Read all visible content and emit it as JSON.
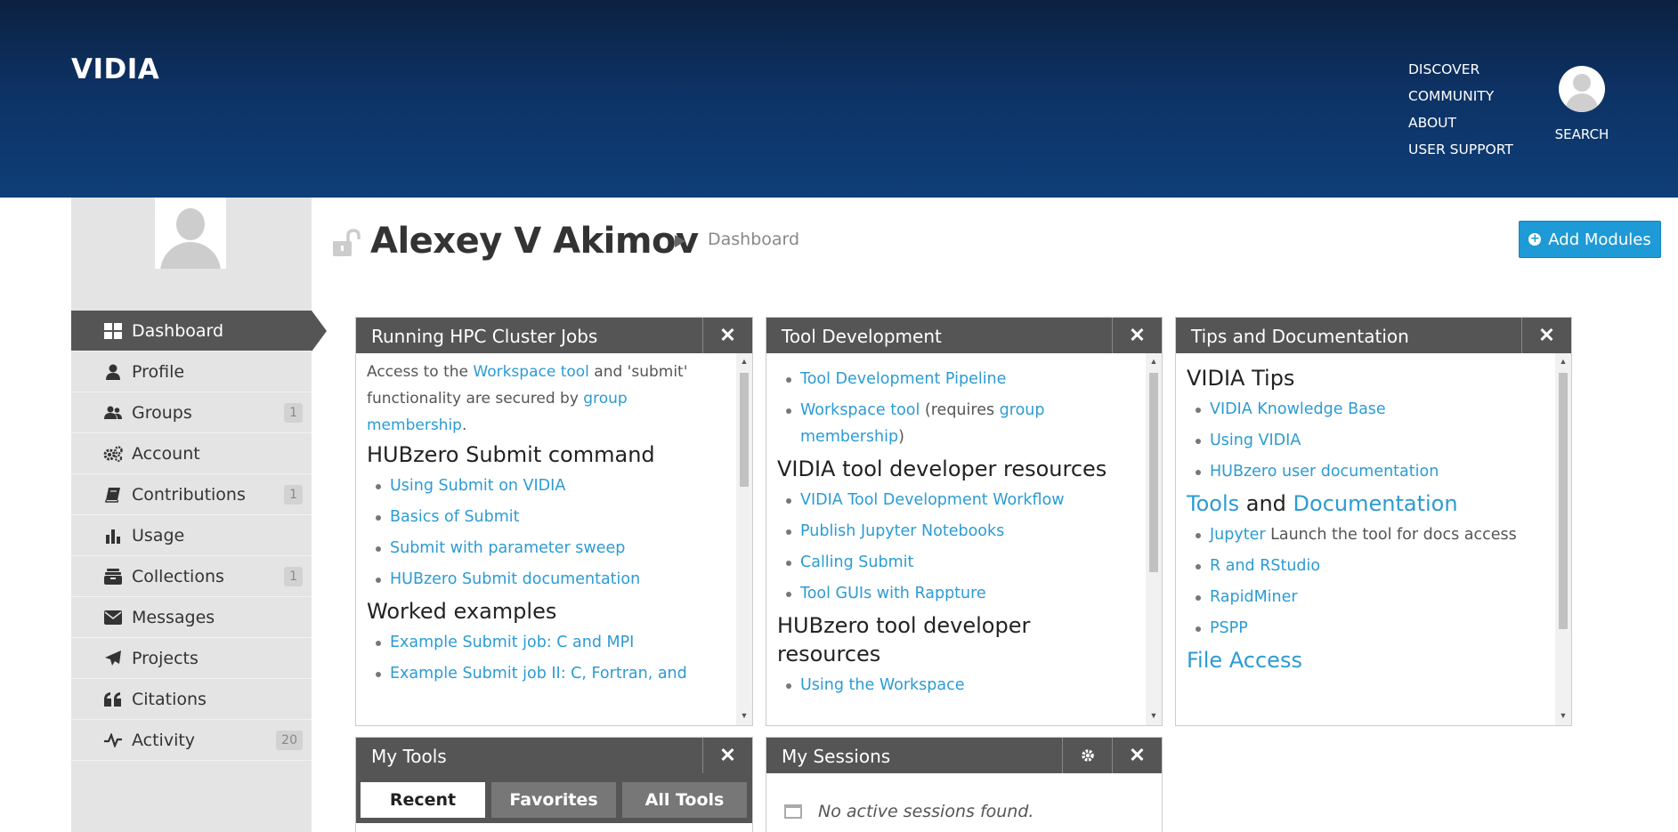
{
  "header": {
    "logo": "VIDIA",
    "nav": [
      "DISCOVER",
      "COMMUNITY",
      "ABOUT",
      "USER SUPPORT"
    ],
    "search_label": "SEARCH"
  },
  "sidebar": {
    "items": [
      {
        "label": "Dashboard",
        "icon": "dashboard-icon",
        "badge": ""
      },
      {
        "label": "Profile",
        "icon": "user-icon",
        "badge": ""
      },
      {
        "label": "Groups",
        "icon": "groups-icon",
        "badge": "1"
      },
      {
        "label": "Account",
        "icon": "gears-icon",
        "badge": ""
      },
      {
        "label": "Contributions",
        "icon": "book-icon",
        "badge": "1"
      },
      {
        "label": "Usage",
        "icon": "bar-chart-icon",
        "badge": ""
      },
      {
        "label": "Collections",
        "icon": "collections-icon",
        "badge": "1"
      },
      {
        "label": "Messages",
        "icon": "envelope-icon",
        "badge": ""
      },
      {
        "label": "Projects",
        "icon": "paper-plane-icon",
        "badge": ""
      },
      {
        "label": "Citations",
        "icon": "quote-icon",
        "badge": ""
      },
      {
        "label": "Activity",
        "icon": "activity-icon",
        "badge": "20"
      }
    ]
  },
  "page": {
    "title": "Alexey V Akimov",
    "breadcrumb": "Dashboard",
    "add_modules": "Add Modules"
  },
  "panels": {
    "hpc": {
      "title": "Running HPC Cluster Jobs",
      "intro_1": "Access to the ",
      "intro_link_1": "Workspace tool",
      "intro_2": " and 'submit' functionality are secured by ",
      "intro_link_2": "group membership",
      "intro_3": ".",
      "heading_1": "HUBzero Submit command",
      "submit_links": [
        "Using Submit on VIDIA",
        "Basics of Submit",
        "Submit with parameter sweep",
        "HUBzero Submit documentation"
      ],
      "heading_2": "Worked examples",
      "example_links": [
        "Example Submit job: C and MPI",
        "Example Submit job II: C, Fortran, and"
      ]
    },
    "tooldev": {
      "title": "Tool Development",
      "link_pipeline": "Tool Development Pipeline",
      "link_workspace": "Workspace tool",
      "requires_text": " (requires ",
      "link_membership": "group membership",
      "close_paren": ")",
      "heading_1": "VIDIA tool developer resources",
      "vidia_links": [
        "VIDIA Tool Development Workflow",
        "Publish Jupyter Notebooks",
        "Calling Submit",
        "Tool GUIs with Rappture"
      ],
      "heading_2": "HUBzero tool developer resources",
      "hub_links": [
        "Using the Workspace"
      ]
    },
    "tips": {
      "title": "Tips and Documentation",
      "heading_1": "VIDIA Tips",
      "tips_links": [
        "VIDIA Knowledge Base",
        "Using VIDIA",
        "HUBzero user documentation"
      ],
      "tools_link": "Tools",
      "and_text": " and ",
      "docs_link": "Documentation",
      "jupyter_link": "Jupyter",
      "jupyter_text": " Launch the tool for docs access",
      "tool_links": [
        "R and RStudio",
        "RapidMiner",
        "PSPP"
      ],
      "file_access": "File Access"
    },
    "mytools": {
      "title": "My Tools",
      "tabs": [
        "Recent",
        "Favorites",
        "All Tools"
      ]
    },
    "sessions": {
      "title": "My Sessions",
      "empty": "No active sessions found."
    }
  },
  "colors": {
    "header_gradient_top": "#0c2140",
    "header_gradient_bottom": "#0f3e78",
    "link": "#2c9bd3",
    "button": "#1e9ad6",
    "panel_header": "#555555",
    "sidebar_bg": "#e4e4e4"
  }
}
